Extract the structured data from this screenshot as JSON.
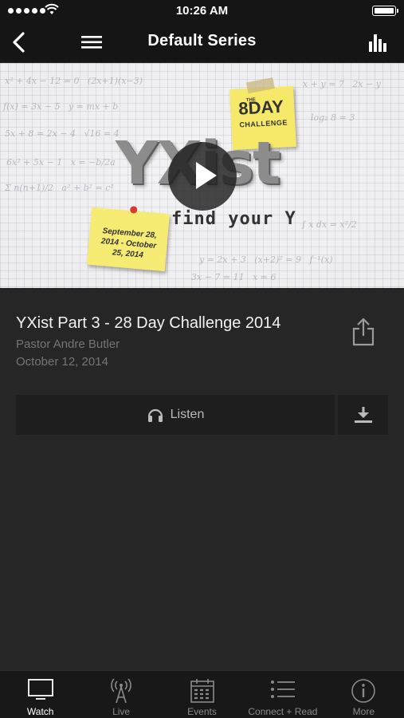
{
  "status_bar": {
    "time": "10:26 AM"
  },
  "navbar": {
    "title": "Default Series"
  },
  "hero": {
    "logo_text": "YXist",
    "tagline": "find your Y",
    "note_top_big": "8DAY",
    "note_top_the": "THE",
    "note_top_small": "CHALLENGE",
    "note_dates": "September 28, 2014 - October 25, 2014"
  },
  "media": {
    "title": "YXist Part 3 - 28 Day Challenge 2014",
    "speaker": "Pastor Andre Butler",
    "date": "October 12, 2014",
    "listen_label": "Listen"
  },
  "tabs": [
    {
      "label": "Watch",
      "icon": "tv-icon",
      "active": true
    },
    {
      "label": "Live",
      "icon": "broadcast-tower-icon",
      "active": false
    },
    {
      "label": "Events",
      "icon": "calendar-icon",
      "active": false
    },
    {
      "label": "Connect + Read",
      "icon": "list-icon",
      "active": false
    },
    {
      "label": "More",
      "icon": "info-icon",
      "active": false
    }
  ],
  "colors": {
    "background": "#262626",
    "bar": "#151515",
    "muted_text": "#757575",
    "note_yellow": "#f6e96a"
  }
}
